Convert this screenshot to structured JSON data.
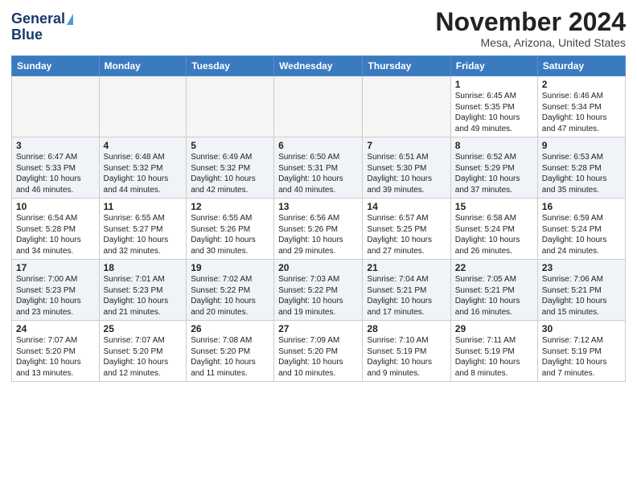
{
  "header": {
    "logo_line1": "General",
    "logo_line2": "Blue",
    "month": "November 2024",
    "location": "Mesa, Arizona, United States"
  },
  "days_of_week": [
    "Sunday",
    "Monday",
    "Tuesday",
    "Wednesday",
    "Thursday",
    "Friday",
    "Saturday"
  ],
  "weeks": [
    [
      {
        "num": "",
        "info": ""
      },
      {
        "num": "",
        "info": ""
      },
      {
        "num": "",
        "info": ""
      },
      {
        "num": "",
        "info": ""
      },
      {
        "num": "",
        "info": ""
      },
      {
        "num": "1",
        "info": "Sunrise: 6:45 AM\nSunset: 5:35 PM\nDaylight: 10 hours\nand 49 minutes."
      },
      {
        "num": "2",
        "info": "Sunrise: 6:46 AM\nSunset: 5:34 PM\nDaylight: 10 hours\nand 47 minutes."
      }
    ],
    [
      {
        "num": "3",
        "info": "Sunrise: 6:47 AM\nSunset: 5:33 PM\nDaylight: 10 hours\nand 46 minutes."
      },
      {
        "num": "4",
        "info": "Sunrise: 6:48 AM\nSunset: 5:32 PM\nDaylight: 10 hours\nand 44 minutes."
      },
      {
        "num": "5",
        "info": "Sunrise: 6:49 AM\nSunset: 5:32 PM\nDaylight: 10 hours\nand 42 minutes."
      },
      {
        "num": "6",
        "info": "Sunrise: 6:50 AM\nSunset: 5:31 PM\nDaylight: 10 hours\nand 40 minutes."
      },
      {
        "num": "7",
        "info": "Sunrise: 6:51 AM\nSunset: 5:30 PM\nDaylight: 10 hours\nand 39 minutes."
      },
      {
        "num": "8",
        "info": "Sunrise: 6:52 AM\nSunset: 5:29 PM\nDaylight: 10 hours\nand 37 minutes."
      },
      {
        "num": "9",
        "info": "Sunrise: 6:53 AM\nSunset: 5:28 PM\nDaylight: 10 hours\nand 35 minutes."
      }
    ],
    [
      {
        "num": "10",
        "info": "Sunrise: 6:54 AM\nSunset: 5:28 PM\nDaylight: 10 hours\nand 34 minutes."
      },
      {
        "num": "11",
        "info": "Sunrise: 6:55 AM\nSunset: 5:27 PM\nDaylight: 10 hours\nand 32 minutes."
      },
      {
        "num": "12",
        "info": "Sunrise: 6:55 AM\nSunset: 5:26 PM\nDaylight: 10 hours\nand 30 minutes."
      },
      {
        "num": "13",
        "info": "Sunrise: 6:56 AM\nSunset: 5:26 PM\nDaylight: 10 hours\nand 29 minutes."
      },
      {
        "num": "14",
        "info": "Sunrise: 6:57 AM\nSunset: 5:25 PM\nDaylight: 10 hours\nand 27 minutes."
      },
      {
        "num": "15",
        "info": "Sunrise: 6:58 AM\nSunset: 5:24 PM\nDaylight: 10 hours\nand 26 minutes."
      },
      {
        "num": "16",
        "info": "Sunrise: 6:59 AM\nSunset: 5:24 PM\nDaylight: 10 hours\nand 24 minutes."
      }
    ],
    [
      {
        "num": "17",
        "info": "Sunrise: 7:00 AM\nSunset: 5:23 PM\nDaylight: 10 hours\nand 23 minutes."
      },
      {
        "num": "18",
        "info": "Sunrise: 7:01 AM\nSunset: 5:23 PM\nDaylight: 10 hours\nand 21 minutes."
      },
      {
        "num": "19",
        "info": "Sunrise: 7:02 AM\nSunset: 5:22 PM\nDaylight: 10 hours\nand 20 minutes."
      },
      {
        "num": "20",
        "info": "Sunrise: 7:03 AM\nSunset: 5:22 PM\nDaylight: 10 hours\nand 19 minutes."
      },
      {
        "num": "21",
        "info": "Sunrise: 7:04 AM\nSunset: 5:21 PM\nDaylight: 10 hours\nand 17 minutes."
      },
      {
        "num": "22",
        "info": "Sunrise: 7:05 AM\nSunset: 5:21 PM\nDaylight: 10 hours\nand 16 minutes."
      },
      {
        "num": "23",
        "info": "Sunrise: 7:06 AM\nSunset: 5:21 PM\nDaylight: 10 hours\nand 15 minutes."
      }
    ],
    [
      {
        "num": "24",
        "info": "Sunrise: 7:07 AM\nSunset: 5:20 PM\nDaylight: 10 hours\nand 13 minutes."
      },
      {
        "num": "25",
        "info": "Sunrise: 7:07 AM\nSunset: 5:20 PM\nDaylight: 10 hours\nand 12 minutes."
      },
      {
        "num": "26",
        "info": "Sunrise: 7:08 AM\nSunset: 5:20 PM\nDaylight: 10 hours\nand 11 minutes."
      },
      {
        "num": "27",
        "info": "Sunrise: 7:09 AM\nSunset: 5:20 PM\nDaylight: 10 hours\nand 10 minutes."
      },
      {
        "num": "28",
        "info": "Sunrise: 7:10 AM\nSunset: 5:19 PM\nDaylight: 10 hours\nand 9 minutes."
      },
      {
        "num": "29",
        "info": "Sunrise: 7:11 AM\nSunset: 5:19 PM\nDaylight: 10 hours\nand 8 minutes."
      },
      {
        "num": "30",
        "info": "Sunrise: 7:12 AM\nSunset: 5:19 PM\nDaylight: 10 hours\nand 7 minutes."
      }
    ]
  ]
}
